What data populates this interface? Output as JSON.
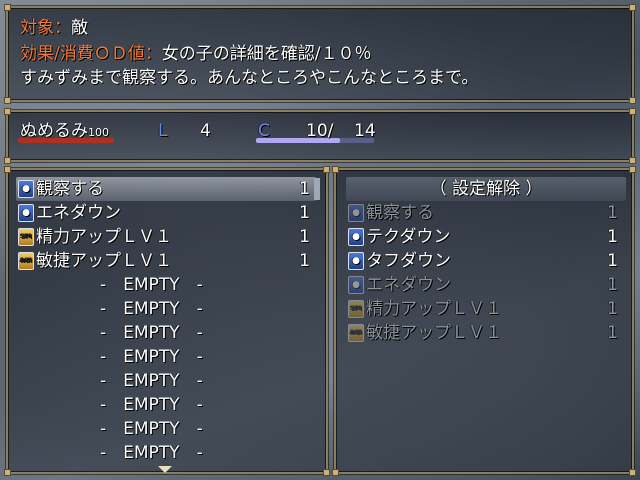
{
  "info": {
    "target_label": "対象：",
    "target_value": "敵",
    "effect_label": "効果/消費ＯＤ値：",
    "effect_value": "女の子の詳細を確認/１０％",
    "description": "すみずみまで観察する。あんなところやこんなところまで。"
  },
  "status": {
    "name": "ぬめるみ",
    "hp": "100",
    "level_label": "L",
    "level": "4",
    "c_label": "C",
    "c_current": "10/",
    "c_max": "14",
    "c_fill_fraction": 0.71
  },
  "left_list": {
    "items": [
      {
        "icon": "eye-skill-icon",
        "label": "観察する",
        "count": "1"
      },
      {
        "icon": "eye-skill-icon",
        "label": "エネダウン",
        "count": "1"
      },
      {
        "icon": "spi-up-icon",
        "label": "精力アップＬＶ１",
        "count": "1",
        "badge": "SPI"
      },
      {
        "icon": "agi-up-icon",
        "label": "敏捷アップＬＶ１",
        "count": "1",
        "badge": "AGI"
      }
    ],
    "empty_label": "-　EMPTY　-",
    "empty_count": 8
  },
  "right_list": {
    "header": "（ 設定解除 ）",
    "items": [
      {
        "icon": "eye-skill-icon",
        "label": "観察する",
        "count": "1",
        "dim": true
      },
      {
        "icon": "eye-skill-icon",
        "label": "テクダウン",
        "count": "1",
        "dim": false
      },
      {
        "icon": "eye-skill-icon",
        "label": "タフダウン",
        "count": "1",
        "dim": false
      },
      {
        "icon": "eye-skill-icon",
        "label": "エネダウン",
        "count": "1",
        "dim": true
      },
      {
        "icon": "spi-up-icon",
        "label": "精力アップＬＶ１",
        "count": "1",
        "dim": true,
        "badge": "SPI"
      },
      {
        "icon": "agi-up-icon",
        "label": "敏捷アップＬＶ１",
        "count": "1",
        "dim": true,
        "badge": "AGI"
      }
    ]
  }
}
